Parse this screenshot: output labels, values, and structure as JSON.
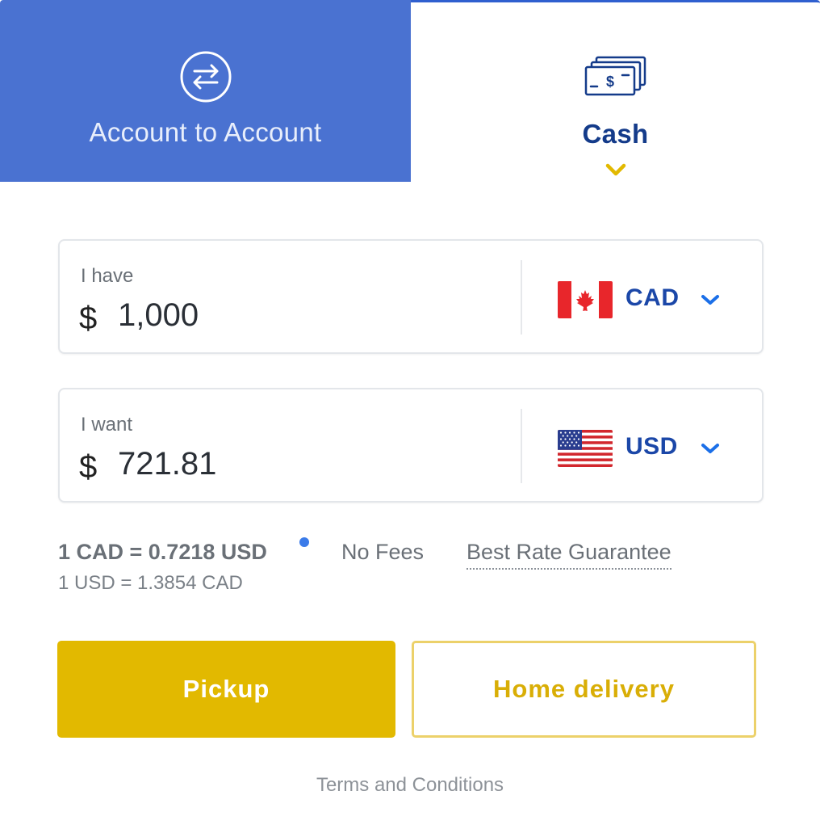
{
  "tabs": {
    "account_to_account": {
      "label": "Account to Account",
      "icon": "swap-arrows-icon",
      "active": false
    },
    "cash": {
      "label": "Cash",
      "icon": "cash-bills-icon",
      "active": true
    }
  },
  "have": {
    "label": "I have",
    "symbol": "$",
    "amount": "1,000",
    "currency": "CAD",
    "flag": "canada-flag-icon"
  },
  "want": {
    "label": "I want",
    "symbol": "$",
    "amount": "721.81",
    "currency": "USD",
    "flag": "usa-flag-icon"
  },
  "rate": {
    "main": "1 CAD = 0.7218 USD",
    "inverse": "1 USD = 1.3854 CAD",
    "no_fees": "No Fees",
    "best_rate": "Best Rate Guarantee"
  },
  "buttons": {
    "pickup": "Pickup",
    "home_delivery": "Home delivery"
  },
  "footer": {
    "terms": "Terms and Conditions"
  },
  "colors": {
    "tab_blue": "#4a72d1",
    "brand_navy": "#143b8a",
    "accent_yellow": "#e2b900",
    "currency_blue": "#1b47a8",
    "info_dot": "#3b7be9"
  }
}
